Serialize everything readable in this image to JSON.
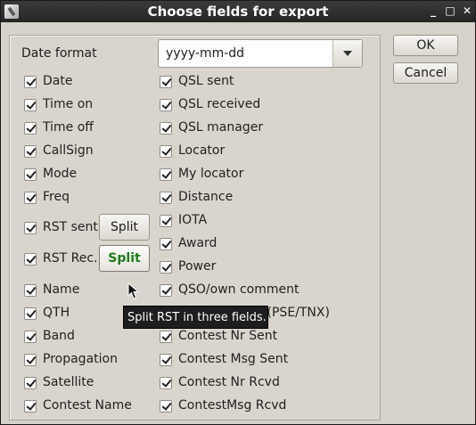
{
  "window": {
    "title": "Choose fields for export",
    "controls": {
      "minimize": "_",
      "maximize": "□",
      "close": "✕"
    }
  },
  "date_format": {
    "label": "Date format",
    "value": "yyyy-mm-dd"
  },
  "left_fields": [
    "Date",
    "Time on",
    "Time off",
    "CallSign",
    "Mode",
    "Freq"
  ],
  "rst": {
    "sent_label": "RST sent",
    "rec_label": "RST Rec.",
    "split_label": "Split"
  },
  "left_fields_lower": [
    "Name",
    "QTH",
    "Band",
    "Propagation",
    "Satellite",
    "Contest Name"
  ],
  "right_fields": [
    "QSL sent",
    "QSL received",
    "QSL manager",
    "Locator",
    "My locator",
    "Distance",
    "IOTA",
    "Award",
    "Power",
    "QSO/own comment",
    "QSL message (PSE/TNX)",
    "Contest Nr Sent",
    "Contest Msg Sent",
    "Contest Nr Rcvd",
    "ContestMsg Rcvd"
  ],
  "buttons": {
    "ok": "OK",
    "cancel": "Cancel"
  },
  "tooltip": "Split RST in three fields.",
  "colors": {
    "titlebar": "#2e2e2e",
    "split_hover_text": "#1e7d1e"
  }
}
